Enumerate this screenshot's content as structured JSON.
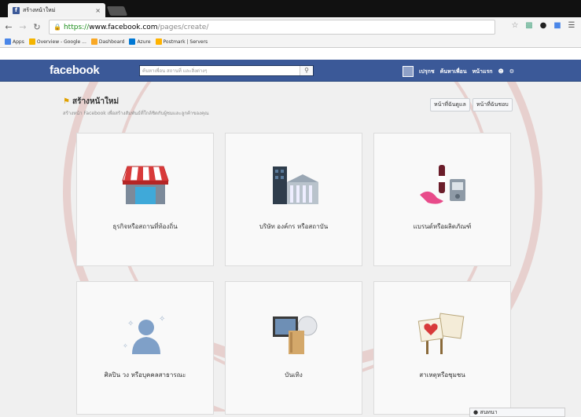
{
  "browser": {
    "tab_title": "สร้างหน้าใหม่",
    "tab_close": "×",
    "url_scheme": "https://",
    "url_host": "www.facebook.com",
    "url_path": "/pages/create/",
    "bookmarks": [
      {
        "label": "Apps",
        "color": "#4a86e8"
      },
      {
        "label": "Overview - Google ...",
        "color": "#f4b400"
      },
      {
        "label": "Dashboard",
        "color": "#f9a825"
      },
      {
        "label": "Azure",
        "color": "#0078d4"
      },
      {
        "label": "Postmark | Servers",
        "color": "#ffb300"
      }
    ]
  },
  "facebook": {
    "logo": "facebook",
    "search_placeholder": "ค้นหาเพื่อน สถานที่ และสิ่งต่างๆ",
    "nav": [
      "เปรุกช",
      "ค้นหาเพื่อน",
      "หน้าแรก"
    ],
    "brand_color": "#3b5998"
  },
  "page": {
    "title": "สร้างหน้าใหม่",
    "subtitle": "สร้างหน้า Facebook เพื่อสร้างสัมพันธ์ที่ใกล้ชิดกับผู้ชมและลูกค้าของคุณ",
    "buttons": [
      "หน้าที่ฉันดูแล",
      "หน้าที่ฉันชอบ"
    ]
  },
  "categories": [
    {
      "label": "ธุรกิจหรือสถานที่ท้องถิ่น",
      "icon": "store-icon"
    },
    {
      "label": "บริษัท องค์กร หรือสถาบัน",
      "icon": "building-icon"
    },
    {
      "label": "แบรนด์หรือผลิตภัณฑ์",
      "icon": "brand-products-icon"
    },
    {
      "label": "ศิลปิน วง หรือบุคคลสาธารณะ",
      "icon": "public-figure-icon"
    },
    {
      "label": "บันเทิง",
      "icon": "entertainment-icon"
    },
    {
      "label": "สาเหตุหรือชุมชน",
      "icon": "cause-community-icon"
    }
  ],
  "help": {
    "label": "สนทนา"
  }
}
